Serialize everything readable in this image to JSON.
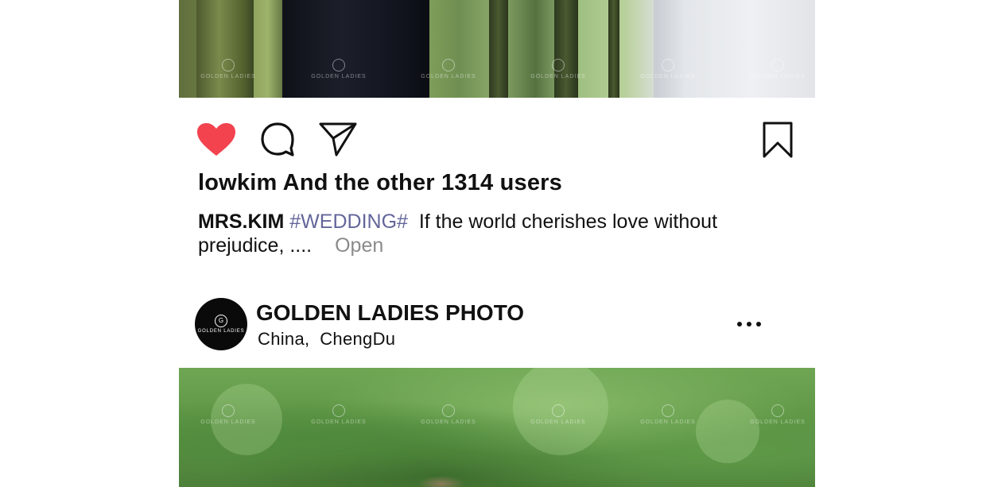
{
  "post1": {
    "likes_text": "lowkim And the other 1314 users",
    "caption": {
      "username": "MRS.KIM",
      "hashtag": "#WEDDING#",
      "text": "If the world cherishes love without prejudice, ....",
      "open_label": "Open"
    },
    "actions": {
      "like_icon": "heart-icon",
      "like_color": "#f2434f",
      "comment_icon": "comment-icon",
      "share_icon": "send-icon",
      "save_icon": "bookmark-icon"
    }
  },
  "post2": {
    "account_name": "GOLDEN LADIES PHOTO",
    "location_country": "China,",
    "location_city": "ChengDu",
    "avatar_text": "GOLDEN LADIES",
    "avatar_mark": "G",
    "more_icon": "more-dots-icon"
  },
  "watermark_text": "GOLDEN LADIES"
}
